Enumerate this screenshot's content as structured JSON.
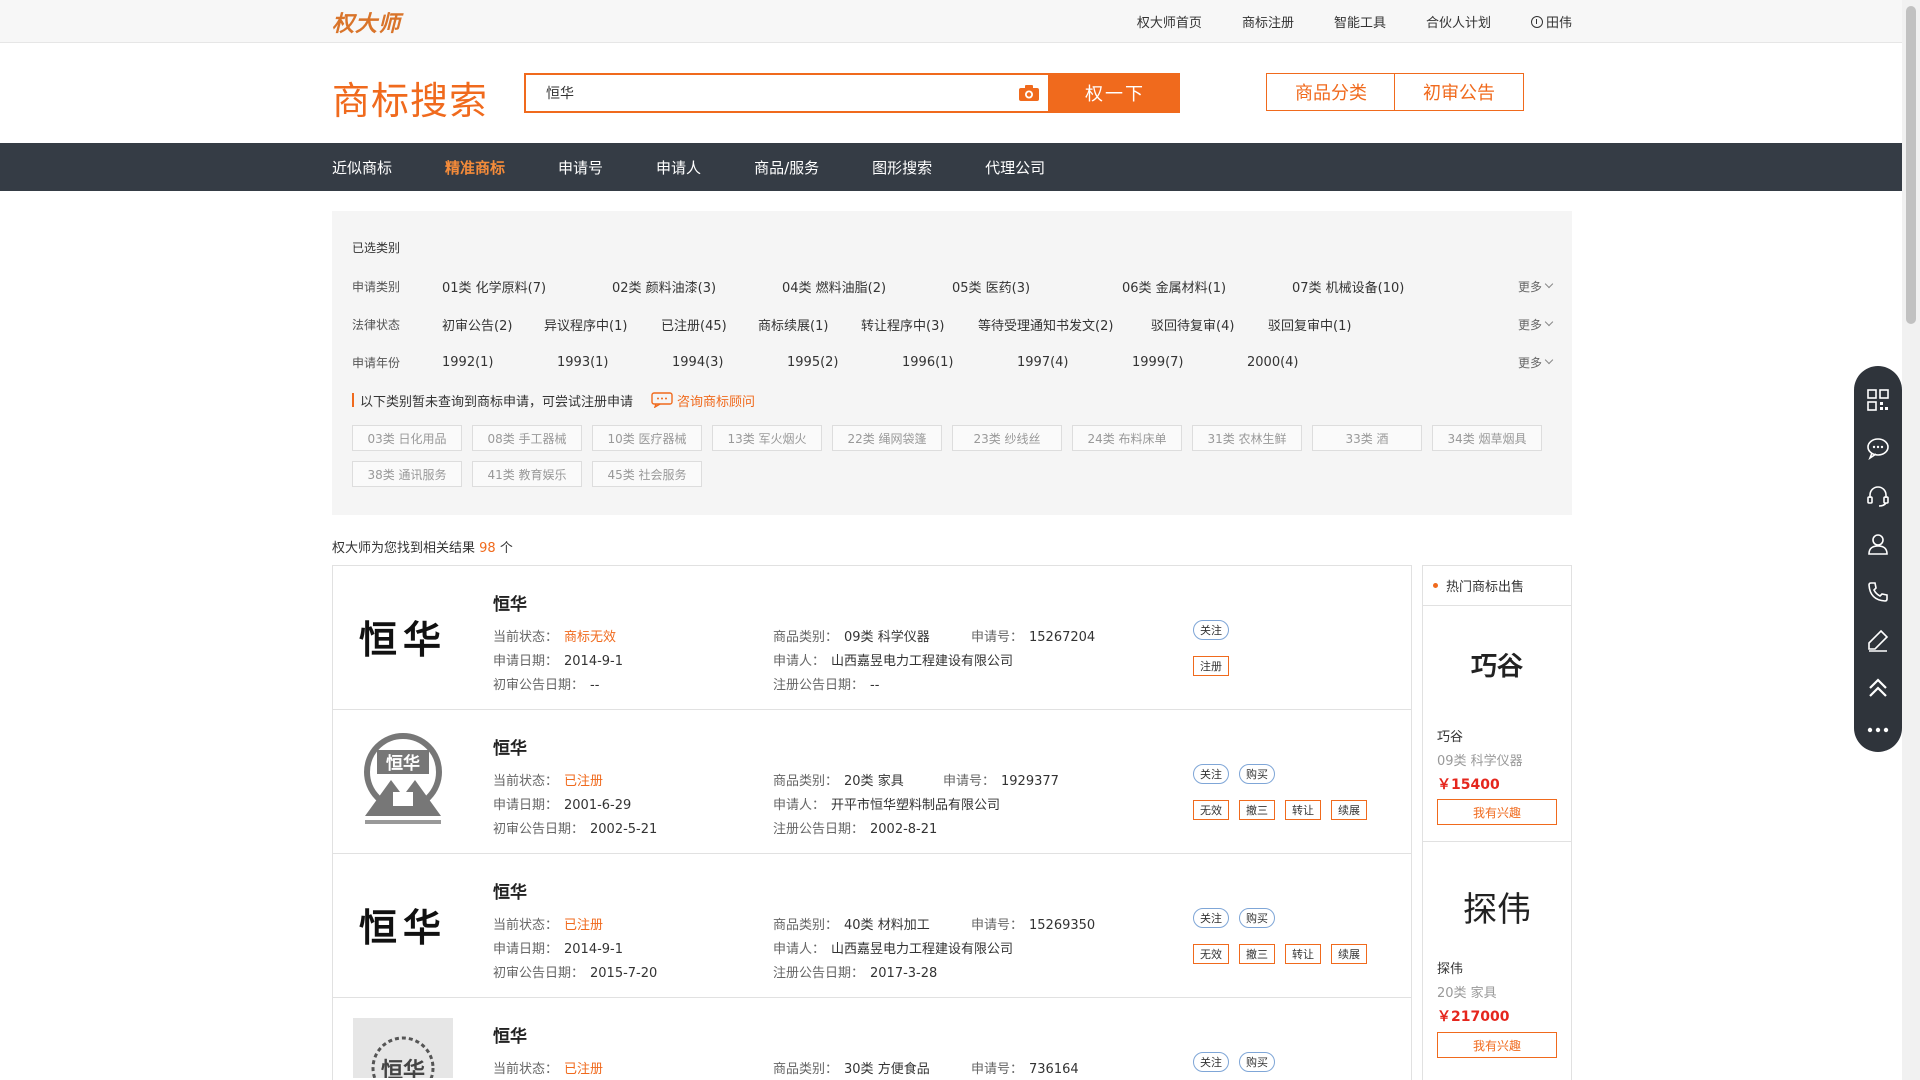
{
  "topbar": {
    "logo": "权大师",
    "nav": [
      "权大师首页",
      "商标注册",
      "智能工具",
      "合伙人计划"
    ],
    "user_name": "田伟"
  },
  "header": {
    "title": "商标搜索",
    "search_value": "恒华",
    "search_button": "权一下",
    "btn_category": "商品分类",
    "btn_announce": "初审公告"
  },
  "mainnav": {
    "items": [
      "近似商标",
      "精准商标",
      "申请号",
      "申请人",
      "商品/服务",
      "图形搜索",
      "代理公司"
    ],
    "active_index": 1
  },
  "filter": {
    "selected_label": "已选类别",
    "rows": [
      {
        "label": "申请类别",
        "items": [
          "01类 化学原料(7)",
          "02类 颜料油漆(3)",
          "04类 燃料油脂(2)",
          "05类 医药(3)",
          "06类 金属材料(1)",
          "07类 机械设备(10)"
        ],
        "more": "更多"
      },
      {
        "label": "法律状态",
        "items": [
          "初审公告(2)",
          "异议程序中(1)",
          "已注册(45)",
          "商标续展(1)",
          "转让程序中(3)",
          "等待受理通知书发文(2)",
          "驳回待复审(4)",
          "驳回复审中(1)"
        ],
        "more": "更多"
      },
      {
        "label": "申请年份",
        "items": [
          "1992(1)",
          "1993(1)",
          "1994(3)",
          "1995(2)",
          "1996(1)",
          "1997(4)",
          "1999(7)",
          "2000(4)"
        ],
        "more": "更多"
      }
    ],
    "notice": "以下类别暂未查询到商标申请，可尝试注册申请",
    "consult": "咨询商标顾问",
    "tags": [
      "03类 日化用品",
      "08类 手工器械",
      "10类 医疗器械",
      "13类 军火烟火",
      "22类 绳网袋篷",
      "23类 纱线丝",
      "24类 布料床单",
      "31类 农林生鲜",
      "33类 酒",
      "34类 烟草烟具",
      "38类 通讯服务",
      "41类 教育娱乐",
      "45类 社会服务"
    ]
  },
  "summary": {
    "prefix": "权大师为您找到相关结果",
    "count": "98",
    "suffix": "个"
  },
  "results": [
    {
      "name": "恒华",
      "status_label": "当前状态：",
      "status": "商标无效",
      "apply_date_label": "申请日期：",
      "apply_date": "2014-9-1",
      "pre_date_label": "初审公告日期：",
      "pre_date": "--",
      "class_label": "商品类别：",
      "class": "09类 科学仪器",
      "regno_label": "申请号：",
      "regno": "15267204",
      "applicant_label": "申请人：",
      "applicant": "山西嘉昱电力工程建设有限公司",
      "reg_date_label": "注册公告日期：",
      "reg_date": "--",
      "pills": [
        "关注"
      ],
      "actions": [
        "注册"
      ]
    },
    {
      "name": "恒华",
      "status_label": "当前状态：",
      "status": "已注册",
      "apply_date_label": "申请日期：",
      "apply_date": "2001-6-29",
      "pre_date_label": "初审公告日期：",
      "pre_date": "2002-5-21",
      "class_label": "商品类别：",
      "class": "20类 家具",
      "regno_label": "申请号：",
      "regno": "1929377",
      "applicant_label": "申请人：",
      "applicant": "开平市恒华塑料制品有限公司",
      "reg_date_label": "注册公告日期：",
      "reg_date": "2002-8-21",
      "pills": [
        "关注",
        "购买"
      ],
      "actions": [
        "无效",
        "撤三",
        "转让",
        "续展"
      ]
    },
    {
      "name": "恒华",
      "status_label": "当前状态：",
      "status": "已注册",
      "apply_date_label": "申请日期：",
      "apply_date": "2014-9-1",
      "pre_date_label": "初审公告日期：",
      "pre_date": "2015-7-20",
      "class_label": "商品类别：",
      "class": "40类 材料加工",
      "regno_label": "申请号：",
      "regno": "15269350",
      "applicant_label": "申请人：",
      "applicant": "山西嘉昱电力工程建设有限公司",
      "reg_date_label": "注册公告日期：",
      "reg_date": "2017-3-28",
      "pills": [
        "关注",
        "购买"
      ],
      "actions": [
        "无效",
        "撤三",
        "转让",
        "续展"
      ]
    },
    {
      "name": "恒华",
      "status_label": "当前状态：",
      "status": "已注册",
      "class_label": "商品类别：",
      "class": "30类 方便食品",
      "regno_label": "申请号：",
      "regno": "736164",
      "pills": [
        "关注",
        "购买"
      ]
    }
  ],
  "logo_text": "恒华",
  "hot": {
    "title": "热门商标出售",
    "items": [
      {
        "logo": "巧谷",
        "name": "巧谷",
        "class": "09类 科学仪器",
        "price": "￥15400",
        "button": "我有兴趣"
      },
      {
        "logo": "探伟",
        "name": "探伟",
        "class": "20类 家具",
        "price": "￥217000",
        "button": "我有兴趣"
      }
    ]
  },
  "float_bar": {
    "icons": [
      "qrcode-icon",
      "chat-icon",
      "headset-icon",
      "user-icon",
      "phone-icon",
      "edit-icon",
      "back-to-top-icon",
      "more-icon"
    ]
  }
}
